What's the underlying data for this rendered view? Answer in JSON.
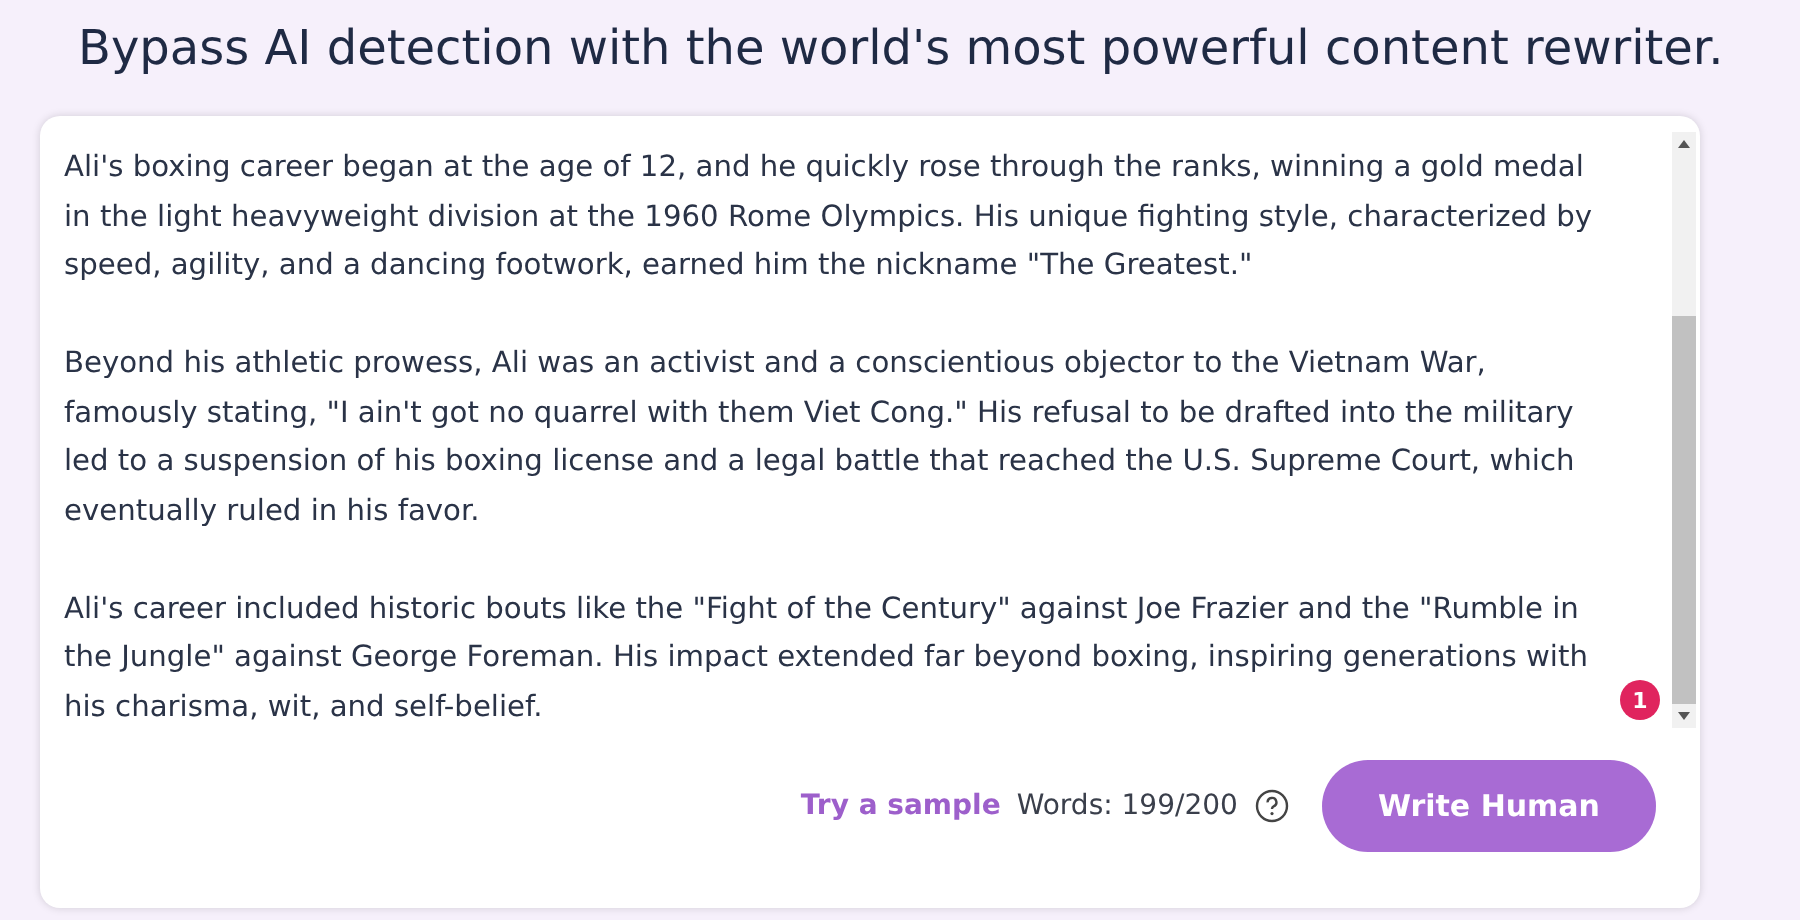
{
  "heading": "Bypass AI detection with the world's most powerful content rewriter.",
  "editor": {
    "paragraphs": [
      "Ali's boxing career began at the age of 12, and he quickly rose through the ranks, winning a gold medal in the light heavyweight division at the 1960 Rome Olympics. His unique fighting style, characterized by speed, agility, and a dancing footwork, earned him the nickname \"The Greatest.\"",
      "Beyond his athletic prowess, Ali was an activist and a conscientious objector to the Vietnam War, famously stating, \"I ain't got no quarrel with them Viet Cong.\" His refusal to be drafted into the military led to a suspension of his boxing license and a legal battle that reached the U.S. Supreme Court, which eventually ruled in his favor.",
      "Ali's career included historic bouts like the \"Fight of the Century\" against Joe Frazier and the \"Rumble in the Jungle\" against George Foreman. His impact extended far beyond boxing, inspiring generations with his charisma, wit, and self-belief."
    ],
    "badge": "1"
  },
  "footer": {
    "sample_link": "Try a sample",
    "word_count": "Words: 199/200",
    "button": "Write Human"
  }
}
